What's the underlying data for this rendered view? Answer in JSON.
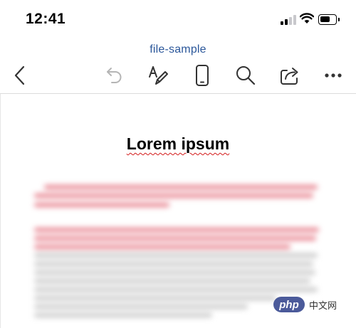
{
  "status_bar": {
    "time": "12:41"
  },
  "document": {
    "file_name": "file-sample",
    "heading": "Lorem ipsum"
  },
  "toolbar": {
    "back_icon": "chevron-left-icon",
    "undo_icon": "undo-icon",
    "draw_icon": "draw-pen-icon",
    "mobile_view_icon": "mobile-view-icon",
    "search_icon": "search-icon",
    "share_icon": "share-icon",
    "more_icon": "more-dots-icon"
  },
  "watermark": {
    "logo_text": "php",
    "text": "中文网"
  },
  "colors": {
    "title_blue": "#2b579a",
    "spell_red": "#d31919",
    "disabled_gray": "#b5b5b5"
  }
}
